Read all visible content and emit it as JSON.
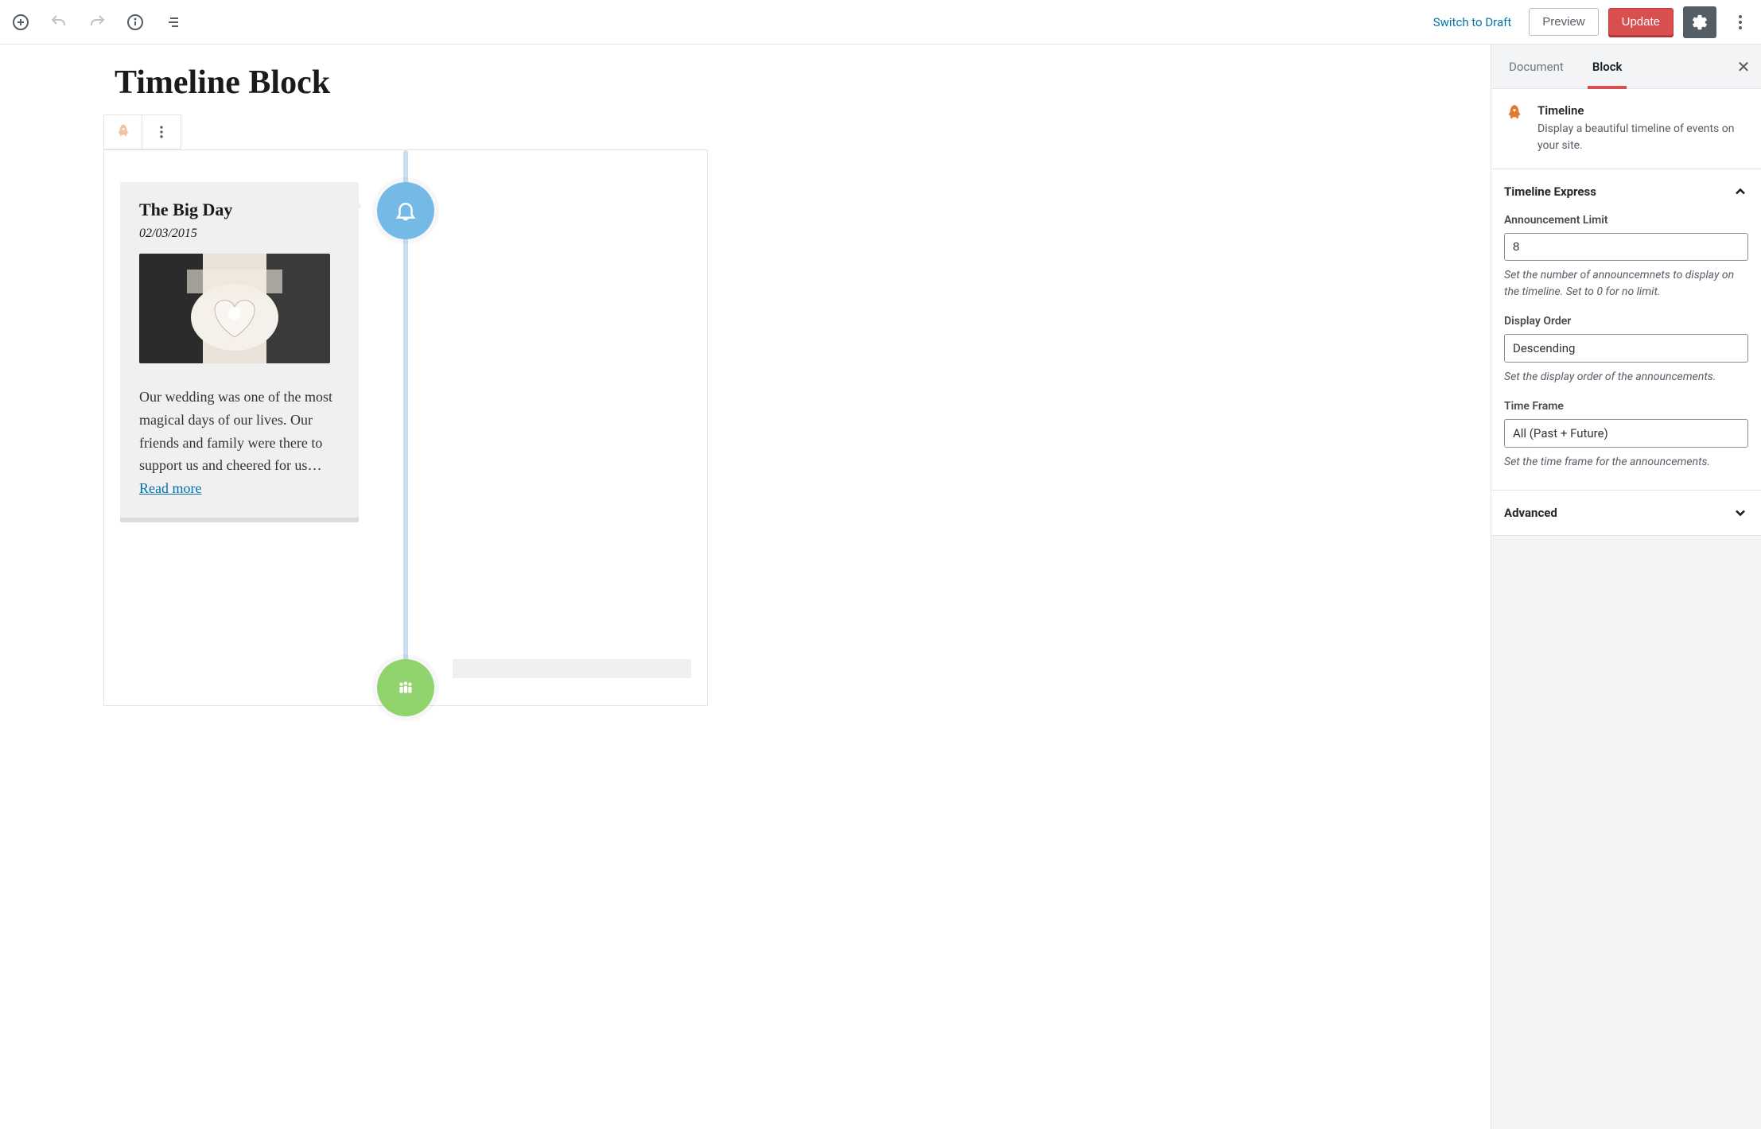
{
  "toolbar": {
    "switch_to_draft": "Switch to Draft",
    "preview": "Preview",
    "update": "Update"
  },
  "editor": {
    "page_title": "Timeline Block"
  },
  "timeline": {
    "card": {
      "title": "The Big Day",
      "date": "02/03/2015",
      "excerpt": "Our wedding was one of the most magical days of our lives. Our friends and family were there to support us and cheered for us…",
      "read_more": "Read more"
    }
  },
  "sidebar": {
    "tabs": {
      "document": "Document",
      "block": "Block"
    },
    "block_info": {
      "title": "Timeline",
      "desc": "Display a beautiful timeline of events on your site."
    },
    "panel_timeline": {
      "title": "Timeline Express",
      "limit_label": "Announcement Limit",
      "limit_value": "8",
      "limit_help": "Set the number of announcemnets to display on the timeline. Set to 0 for no limit.",
      "order_label": "Display Order",
      "order_value": "Descending",
      "order_help": "Set the display order of the announcements.",
      "timeframe_label": "Time Frame",
      "timeframe_value": "All (Past + Future)",
      "timeframe_help": "Set the time frame for the announcements."
    },
    "panel_advanced": {
      "title": "Advanced"
    }
  }
}
